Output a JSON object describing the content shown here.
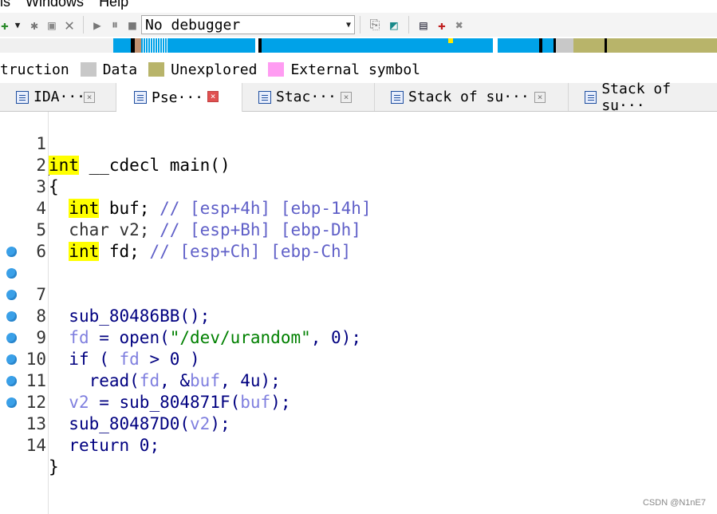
{
  "menu": {
    "items": [
      "ls",
      "Windows",
      "Help"
    ]
  },
  "toolbar": {
    "debugger_value": "No debugger",
    "icons": [
      "add-icon",
      "dropdown-arrow-icon",
      "plugin-icon",
      "save-icon",
      "close-icon",
      "play-icon",
      "pause-icon",
      "stop-icon",
      "attach-icon",
      "run-icon",
      "graph-icon",
      "breakpoint-add-icon",
      "breakpoint-remove-icon"
    ]
  },
  "colors": {
    "regular_function": "#00a2e8",
    "instruction": "#a0a0a0",
    "data": "#c8c8c8",
    "unexplored": "#b8b46a",
    "external_symbol": "#ff9cf2",
    "library_function": "#000000",
    "breakpoint": "#3aa0e8",
    "keyword_highlight": "#ffff00"
  },
  "legend": {
    "instruction_label": "truction",
    "data_label": "Data",
    "unexplored_label": "Unexplored",
    "external_label": "External symbol"
  },
  "tabs": [
    {
      "label": "IDA···",
      "close": "×"
    },
    {
      "label": "Pse···",
      "close": "×"
    },
    {
      "label": "Stac···",
      "close": "×"
    },
    {
      "label": "Stack of su···",
      "close": "×"
    },
    {
      "label": "Stack of su···"
    }
  ],
  "code": {
    "line_numbers": [
      "1",
      "2",
      "3",
      "4",
      "5",
      "6",
      "7",
      "8",
      "9",
      "10",
      "11",
      "12",
      "13",
      "14"
    ],
    "l1": {
      "kw": "int",
      "rest": " __cdecl main()"
    },
    "l2": "{",
    "l3": {
      "kw": "int",
      "name": " buf; ",
      "comment": "// [esp+4h] [ebp-14h]"
    },
    "l4": {
      "name": "char v2; ",
      "comment": "// [esp+Bh] [ebp-Dh]"
    },
    "l5": {
      "kw": "int",
      "name": " fd; ",
      "comment": "// [esp+Ch] [ebp-Ch]"
    },
    "l7": "sub_80486BB();",
    "l8": {
      "var": "fd",
      "a": " = open(",
      "str": "\"/dev/urandom\"",
      "b": ", 0);"
    },
    "l9": {
      "a": "if ( ",
      "var": "fd",
      "b": " > 0 )"
    },
    "l10": {
      "a": "read(",
      "var1": "fd",
      "b": ", &",
      "var2": "buf",
      "c": ", 4u);"
    },
    "l11": {
      "var1": "v2",
      "a": " = sub_804871F(",
      "var2": "buf",
      "b": ");"
    },
    "l12": {
      "a": "sub_80487D0(",
      "var": "v2",
      "b": ");"
    },
    "l13": "return 0;",
    "l14": "}"
  },
  "watermark": "CSDN @N1nE7"
}
